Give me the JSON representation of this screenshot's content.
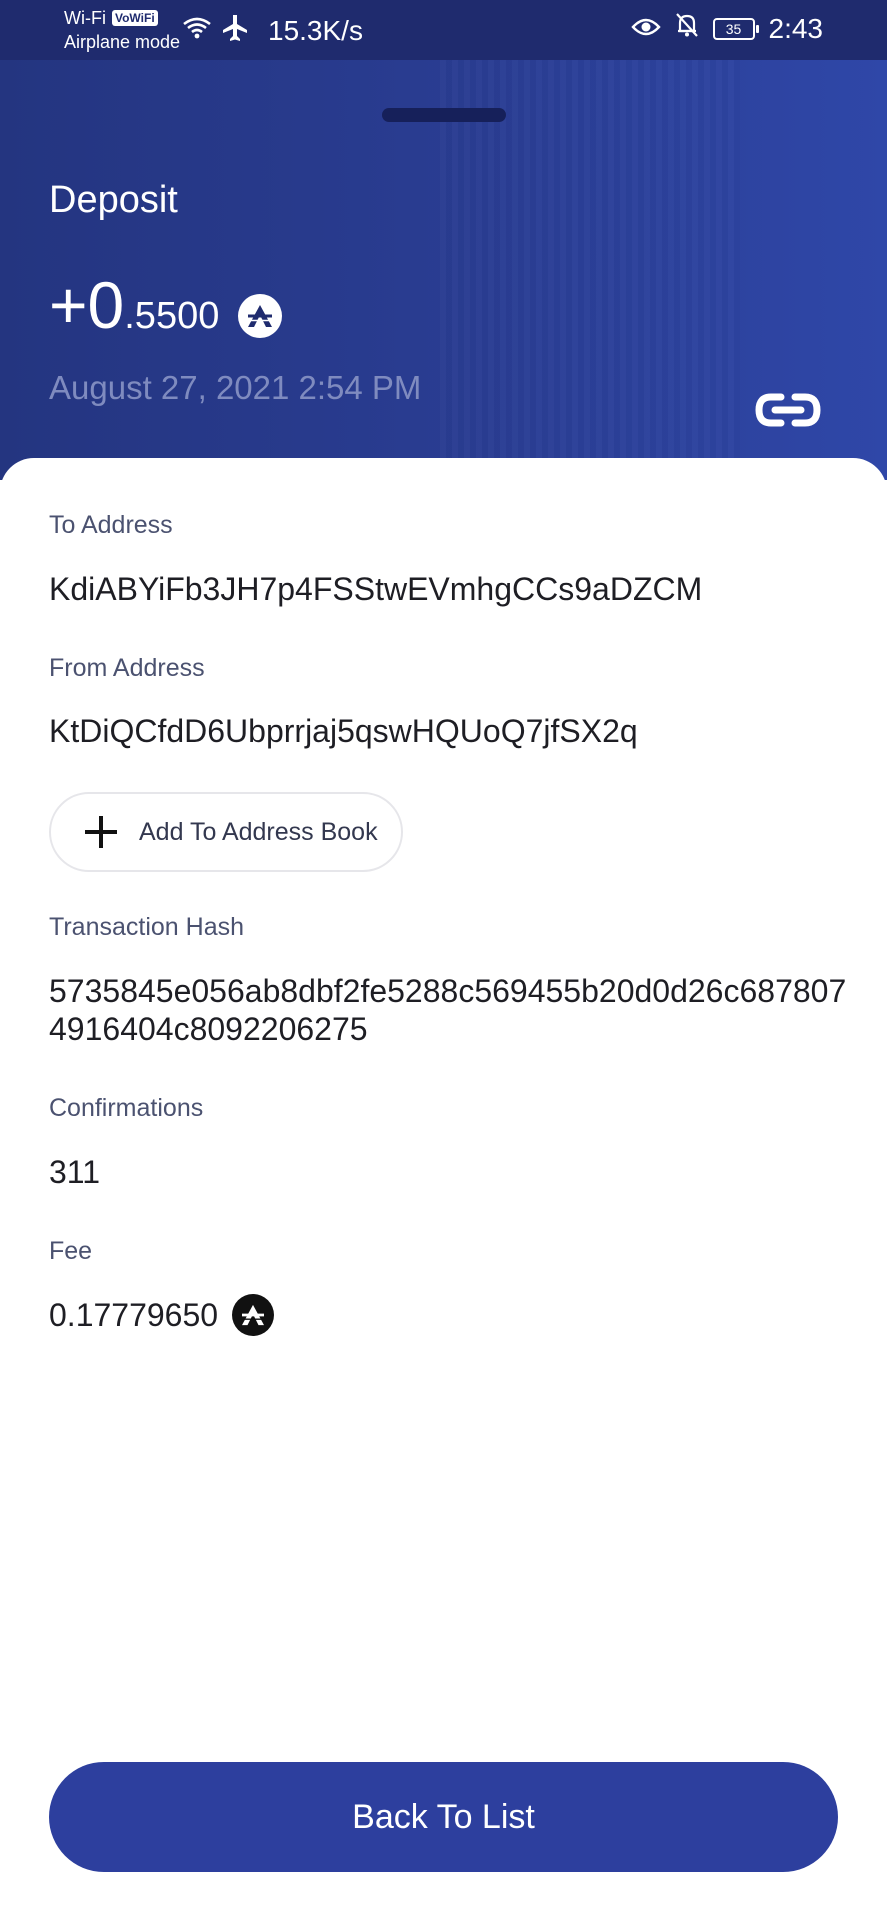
{
  "status_bar": {
    "wifi_label": "Wi-Fi",
    "vowifi_badge": "VoWiFi",
    "airplane_label": "Airplane mode",
    "speed": "15.3K/s",
    "battery": "35",
    "time": "2:43",
    "icons": [
      "wifi-icon",
      "airplane-icon",
      "eye-icon",
      "bell-off-icon",
      "battery-icon"
    ]
  },
  "header": {
    "type": "Deposit",
    "amount_main": "+0",
    "amount_decimal": ".5500",
    "date": "August 27, 2021 2:54 PM",
    "coin_icon": "astra-coin-icon",
    "link_icon": "link-icon"
  },
  "details": {
    "to_label": "To Address",
    "to_value": "KdiABYiFb3JH7p4FSStwEVmhgCCs9aDZCM",
    "from_label": "From Address",
    "from_value": "KtDiQCfdD6Ubprrjaj5qswHQUoQ7jfSX2q",
    "add_book_label": "Add To Address Book",
    "hash_label": "Transaction Hash",
    "hash_value": "5735845e056ab8dbf2fe5288c569455b20d0d26c6878074916404c8092206275",
    "confirmations_label": "Confirmations",
    "confirmations_value": "311",
    "fee_label": "Fee",
    "fee_value": "0.17779650"
  },
  "footer": {
    "back_label": "Back To List"
  },
  "colors": {
    "header_bg": "#2a3d93",
    "status_bg": "#1f2b6e",
    "accent_button": "#2d3f9e",
    "date_text": "#7f8bbf"
  }
}
